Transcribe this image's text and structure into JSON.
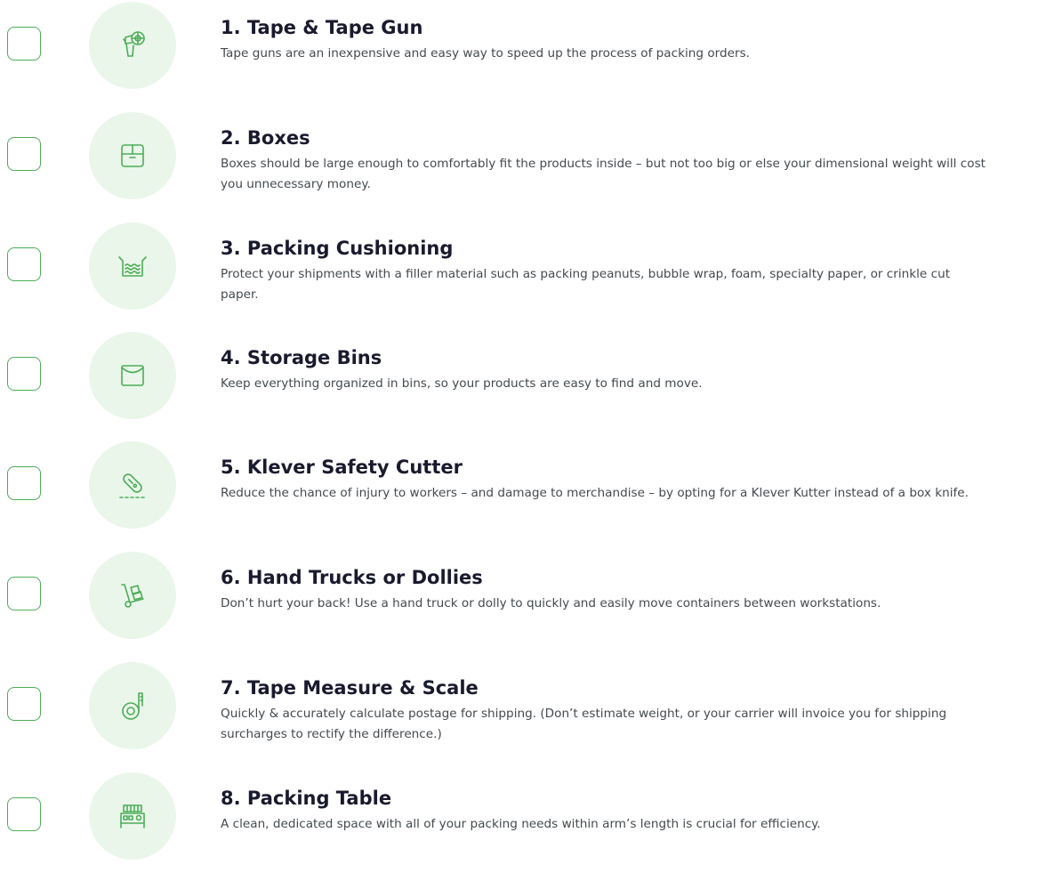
{
  "accent_color": "#4cae58",
  "icon_bg_color": "#eaf6ea",
  "items": [
    {
      "title": "1. Tape & Tape Gun",
      "description": "Tape guns are an inexpensive and easy way to speed up the process of packing orders.",
      "icon": "tape-gun-icon"
    },
    {
      "title": "2. Boxes",
      "description": "Boxes should be large enough to comfortably fit the products inside – but not too big or else your dimensional weight will cost you unnecessary money.",
      "icon": "box-icon"
    },
    {
      "title": "3. Packing Cushioning",
      "description": "Protect your shipments with a filler material such as packing peanuts, bubble wrap, foam, specialty paper, or crinkle cut paper.",
      "icon": "cushioning-icon"
    },
    {
      "title": "4. Storage Bins",
      "description": "Keep everything organized in bins, so your products are easy to find and move.",
      "icon": "storage-bin-icon"
    },
    {
      "title": "5. Klever Safety Cutter",
      "description": "Reduce the chance of injury to workers – and damage to merchandise – by opting for a Klever Kutter instead of a box knife.",
      "icon": "safety-cutter-icon"
    },
    {
      "title": "6. Hand Trucks or Dollies",
      "description": "Don’t hurt your back! Use a hand truck or dolly to quickly and easily move containers between workstations.",
      "icon": "hand-truck-icon"
    },
    {
      "title": "7. Tape Measure & Scale",
      "description": "Quickly & accurately calculate postage for shipping. (Don’t estimate weight, or your carrier will invoice you for shipping surcharges to rectify the difference.)",
      "icon": "tape-measure-icon"
    },
    {
      "title": "8. Packing Table",
      "description": "A clean, dedicated space with all of your packing needs within arm’s length is crucial for efficiency.",
      "icon": "packing-table-icon"
    }
  ]
}
